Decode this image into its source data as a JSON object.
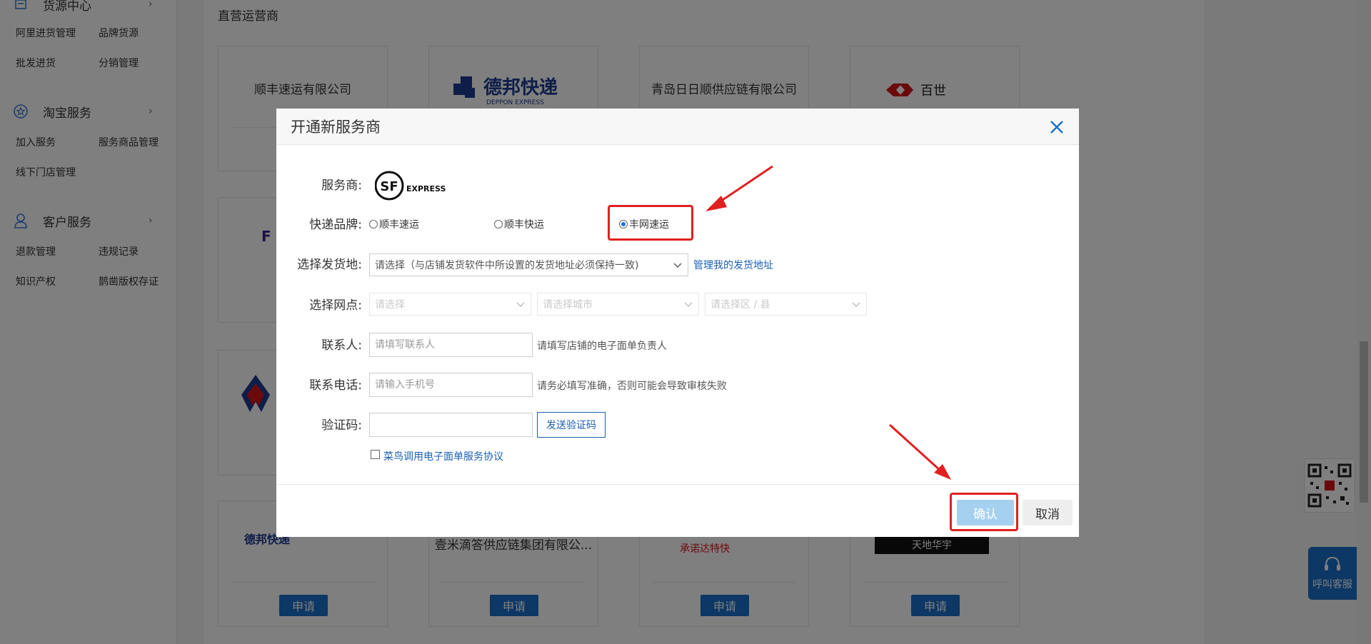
{
  "sidebar": {
    "resource_center": {
      "title": "货源中心",
      "icon": "box-icon",
      "links": [
        "阿里进货管理",
        "品牌货源",
        "批发进货",
        "分销管理"
      ]
    },
    "taobao_service": {
      "title": "淘宝服务",
      "icon": "star-circle-icon",
      "links": [
        "加入服务",
        "服务商品管理",
        "线下门店管理"
      ]
    },
    "customer_service": {
      "title": "客户服务",
      "icon": "user-icon",
      "links": [
        "退款管理",
        "违规记录",
        "知识产权",
        "鹊凿版权存证"
      ]
    }
  },
  "main": {
    "section_title": "直营运营商",
    "cards": [
      {
        "name": "顺丰速运有限公司"
      },
      {
        "name": "",
        "logo": "deppon-logo",
        "logo_text": "德邦快递",
        "logo_subtext": "DEPPON EXPRESS"
      },
      {
        "name": "青岛日日顺供应链有限公司"
      },
      {
        "name": "",
        "logo": "baishi-logo",
        "logo_text": "百世"
      }
    ],
    "bottom_cards": [
      {
        "name": "",
        "logo": "deppon-logo",
        "logo_text": "德邦快递"
      },
      {
        "name": "壹米滴答供应链集团有限公..."
      },
      {
        "name": "",
        "logo": "annengda-logo",
        "logo_text": "承诺达特快"
      },
      {
        "name": "",
        "logo": "tiandi-logo",
        "logo_text": "天地华宇"
      }
    ],
    "apply_label": "申请"
  },
  "widgets": {
    "customer_service_label": "呼叫客服",
    "qr_icon": "qr-code-icon"
  },
  "modal": {
    "title": "开通新服务商",
    "provider_label": "服务商:",
    "provider_logo_text": "SF",
    "provider_logo_subtext": "EXPRESS",
    "brand_label": "快递品牌:",
    "brands": [
      {
        "label": "顺丰速运",
        "selected": false
      },
      {
        "label": "顺丰快运",
        "selected": false
      },
      {
        "label": "丰网速运",
        "selected": true
      }
    ],
    "address_label": "选择发货地:",
    "address_select": "请选择（与店铺发货软件中所设置的发货地址必须保持一致)",
    "manage_address_link": "管理我的发货地址",
    "outlet_label": "选择网点:",
    "outlet_selects": [
      "请选择",
      "请选择城市",
      "请选择区 / 县"
    ],
    "contact_label": "联系人:",
    "contact_placeholder": "请填写联系人",
    "contact_hint": "请填写店铺的电子面单负责人",
    "phone_label": "联系电话:",
    "phone_placeholder": "请输入手机号",
    "phone_hint": "请务必填写准确，否则可能会导致审核失败",
    "code_label": "验证码:",
    "code_value": "",
    "send_code_label": "发送验证码",
    "agreement_label": "菜鸟调用电子面单服务协议",
    "agreement_checked": false,
    "confirm_label": "确认",
    "cancel_label": "取消"
  },
  "colors": {
    "accent": "#1a6fc9",
    "highlight": "#e02020",
    "overlay": "rgba(0,0,0,0.5)"
  }
}
